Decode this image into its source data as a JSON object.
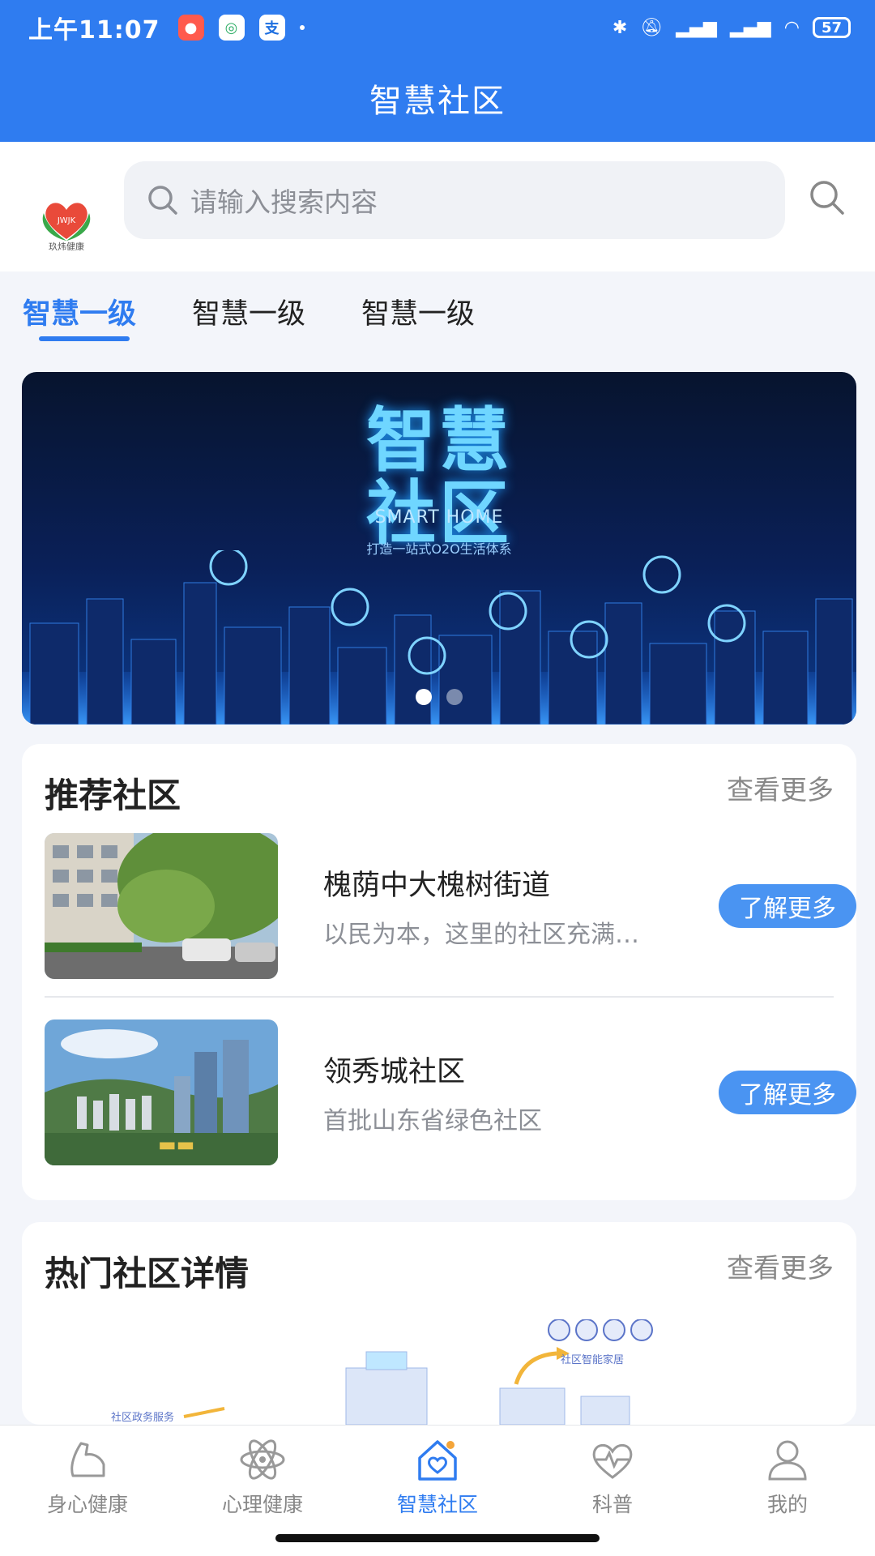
{
  "status_bar": {
    "time": "上午11:07",
    "notif_icons": [
      "app-icon",
      "mobile-icon",
      "pay-icon"
    ],
    "battery": "57"
  },
  "header": {
    "title": "智慧社区",
    "search_placeholder": "请输入搜索内容",
    "logo_text": "玖炜健康"
  },
  "tabs": [
    {
      "label": "智慧一级",
      "active": true
    },
    {
      "label": "智慧一级",
      "active": false
    },
    {
      "label": "智慧一级",
      "active": false
    }
  ],
  "banner": {
    "title_line1": "智慧",
    "title_line2": "社区",
    "subtitle": "SMART HOME",
    "tagline": "打造一站式O2O生活体系",
    "page_count": 2,
    "current_page": 1
  },
  "recommended": {
    "title": "推荐社区",
    "more": "查看更多",
    "items": [
      {
        "name": "槐荫中大槐树街道",
        "desc": "以民为本，这里的社区充满…",
        "button": "了解更多"
      },
      {
        "name": "领秀城社区",
        "desc": "首批山东省绿色社区",
        "button": "了解更多"
      }
    ]
  },
  "hot": {
    "title": "热门社区详情",
    "more": "查看更多",
    "labels": [
      "社区智能家居",
      "社区政务服务"
    ]
  },
  "bottom_nav": [
    {
      "label": "身心健康",
      "icon": "arm-icon",
      "active": false
    },
    {
      "label": "心理健康",
      "icon": "atom-icon",
      "active": false
    },
    {
      "label": "智慧社区",
      "icon": "home-heart-icon",
      "active": true
    },
    {
      "label": "科普",
      "icon": "heartbeat-icon",
      "active": false
    },
    {
      "label": "我的",
      "icon": "user-icon",
      "active": false
    }
  ],
  "colors": {
    "primary": "#2f7cf0",
    "button": "#4a94f2",
    "muted": "#8c8f96"
  }
}
